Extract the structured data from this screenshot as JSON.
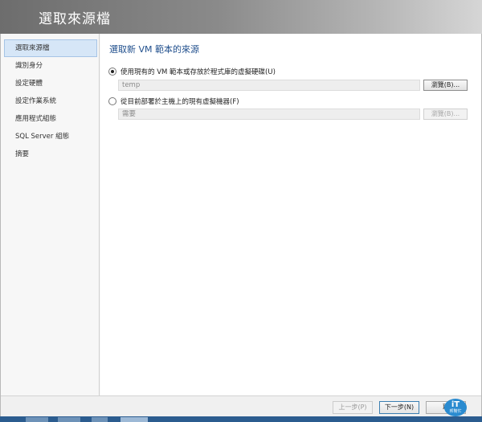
{
  "window": {
    "title": "選取來源檔"
  },
  "sidebar": {
    "items": [
      {
        "label": "選取來源檔",
        "active": true
      },
      {
        "label": "識別身分"
      },
      {
        "label": "設定硬體"
      },
      {
        "label": "設定作業系統"
      },
      {
        "label": "應用程式組態"
      },
      {
        "label": "SQL Server 組態"
      },
      {
        "label": "摘要"
      }
    ]
  },
  "main": {
    "heading": "選取新 VM 範本的來源",
    "option1": {
      "label": "使用現有的 VM 範本或存放於程式庫的虛擬硬碟(U)",
      "selected": true,
      "field_value": "temp",
      "browse_label": "瀏覽(B)..."
    },
    "option2": {
      "label": "從目前部署於主機上的現有虛擬機器(F)",
      "selected": false,
      "field_value": "需要",
      "browse_label": "瀏覽(B)..."
    }
  },
  "footer": {
    "previous_label": "上一步(P)",
    "next_label": "下一步(N)",
    "cancel_label": "取"
  },
  "watermark": {
    "main": "iT",
    "sub": "邦幫忙"
  }
}
